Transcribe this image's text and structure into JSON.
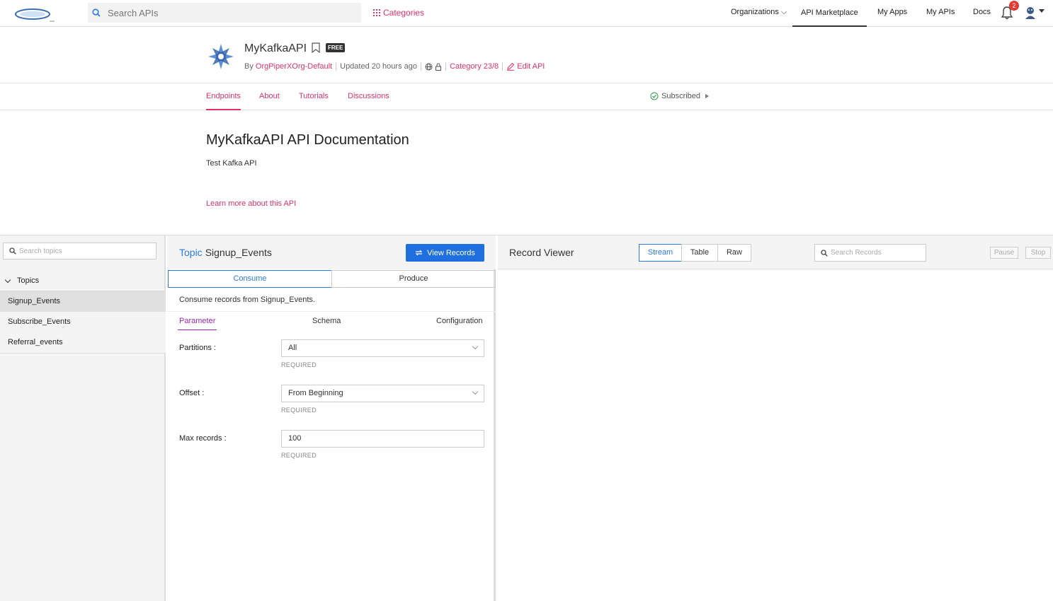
{
  "nav": {
    "search_placeholder": "Search APIs",
    "categories": "Categories",
    "links": {
      "organizations": "Organizations",
      "marketplace": "API Marketplace",
      "my_apps": "My Apps",
      "my_apis": "My APIs",
      "docs": "Docs"
    },
    "notification_count": "2"
  },
  "api": {
    "name": "MyKafkaAPI",
    "badge": "FREE",
    "by_label": "By",
    "org": "OrgPiperXOrg-Default",
    "updated": "Updated 20 hours ago",
    "category": "Category 23/8",
    "edit": "Edit API"
  },
  "tabs": {
    "endpoints": "Endpoints",
    "about": "About",
    "tutorials": "Tutorials",
    "discussions": "Discussions",
    "subscribed": "Subscribed"
  },
  "doc": {
    "title": "MyKafkaAPI API Documentation",
    "description": "Test Kafka API",
    "learn_more": "Learn more about this API"
  },
  "topics": {
    "search_placeholder": "Search topics",
    "heading": "Topics",
    "items": [
      "Signup_Events",
      "Subscribe_Events",
      "Referral_events"
    ]
  },
  "topic_panel": {
    "topic_label": "Topic",
    "topic_name": "Signup_Events",
    "view_records": "View Records",
    "consume": "Consume",
    "produce": "Produce",
    "consume_text": "Consume records from Signup_Events.",
    "subtabs": {
      "parameter": "Parameter",
      "schema": "Schema",
      "configuration": "Configuration"
    },
    "fields": {
      "partitions_label": "Partitions :",
      "partitions_value": "All",
      "offset_label": "Offset :",
      "offset_value": "From Beginning",
      "max_label": "Max records :",
      "max_value": "100",
      "required": "REQUIRED"
    }
  },
  "record_viewer": {
    "title": "Record Viewer",
    "views": [
      "Stream",
      "Table",
      "Raw"
    ],
    "search_placeholder": "Search Records",
    "pause": "Pause",
    "stop": "Stop"
  },
  "colors": {
    "accent_pink": "#e0316b",
    "primary_blue": "#1f6fde",
    "active_purple": "#9c27b0"
  }
}
